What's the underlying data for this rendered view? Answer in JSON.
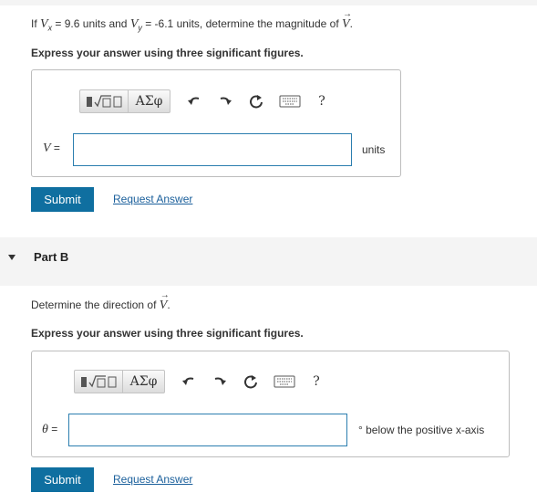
{
  "part_a": {
    "prompt_prefix": "If ",
    "vx_symbol": "V",
    "vx_sub": "x",
    "vx_text": " = 9.6 units and ",
    "vy_symbol": "V",
    "vy_sub": "y",
    "vy_text": " = -6.1 units, determine the magnitude of ",
    "target_symbol": "V",
    "prompt_suffix": ".",
    "instruction": "Express your answer using three significant figures.",
    "toolbar": {
      "templates_label": "■√□",
      "greek_label": "ΑΣφ",
      "help_label": "?"
    },
    "field_symbol": "V",
    "field_eq": " =",
    "field_value": "",
    "unit": "units",
    "submit_label": "Submit",
    "request_label": "Request Answer"
  },
  "part_b": {
    "title": "Part B",
    "prompt_prefix": "Determine the direction of ",
    "target_symbol": "V",
    "prompt_suffix": ".",
    "instruction": "Express your answer using three significant figures.",
    "toolbar": {
      "templates_label": "■√□",
      "greek_label": "ΑΣφ",
      "help_label": "?"
    },
    "field_symbol": "θ",
    "field_eq": " =",
    "field_value": "",
    "unit": "° below the positive x-axis",
    "submit_label": "Submit",
    "request_label": "Request Answer"
  }
}
